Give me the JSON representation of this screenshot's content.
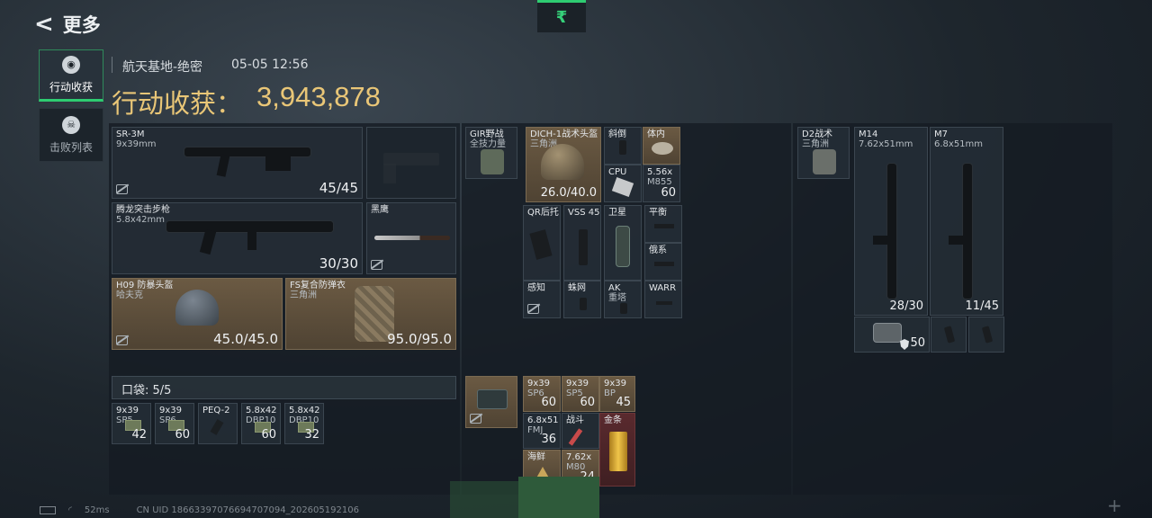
{
  "nav": {
    "back_label": "更多",
    "currency_symbol": "₹"
  },
  "tabs": [
    {
      "label": "行动收获",
      "active": true,
      "icon": "loot-icon"
    },
    {
      "label": "击败列表",
      "active": false,
      "icon": "skull-icon"
    }
  ],
  "raid": {
    "map": "航天基地-绝密",
    "datetime": "05-05 12:56"
  },
  "loot": {
    "label": "行动收获：",
    "value": "3,943,878"
  },
  "gear": {
    "primary": {
      "name": "SR-3M",
      "caliber": "9x39mm",
      "ammo": "45/45"
    },
    "secondary": {
      "name": "腾龙突击步枪",
      "caliber": "5.8x42mm",
      "ammo": "30/30"
    },
    "melee": {
      "name": "黑鹰"
    },
    "helmet": {
      "name": "H09 防暴头盔",
      "maker": "哈夫克",
      "durability": "45.0/45.0"
    },
    "armor": {
      "name": "FS复合防弹衣",
      "maker": "三角洲",
      "durability": "95.0/95.0"
    }
  },
  "pocket": {
    "label": "口袋:",
    "count": "5/5",
    "items": [
      {
        "name": "9x39",
        "sub": "SP5",
        "count": "42"
      },
      {
        "name": "9x39",
        "sub": "SP6",
        "count": "60"
      },
      {
        "name": "PEQ-2",
        "sub": "",
        "count": ""
      },
      {
        "name": "5.8x42",
        "sub": "DBP10",
        "count": "60"
      },
      {
        "name": "5.8x42",
        "sub": "DBP10",
        "count": "32"
      }
    ]
  },
  "rig": {
    "name": "GIR野战",
    "sub": "全技力量",
    "helmet_item": {
      "name": "DICH-1战术头盔",
      "sub": "三角洲",
      "durability": "26.0/40.0"
    },
    "small_items": [
      {
        "name": "斜倒",
        "count": ""
      },
      {
        "name": "体内",
        "count": ""
      },
      {
        "name": "CPU",
        "count": ""
      },
      {
        "name": "5.56x",
        "sub": "M855",
        "count": "60"
      },
      {
        "name": "QR后托",
        "count": ""
      },
      {
        "name": "VSS 45",
        "count": ""
      },
      {
        "name": "卫星",
        "count": ""
      },
      {
        "name": "平衡",
        "count": ""
      },
      {
        "name": "俄系",
        "count": ""
      },
      {
        "name": "感知",
        "count": ""
      },
      {
        "name": "蛛网",
        "count": ""
      },
      {
        "name": "AK",
        "sub": "重塔",
        "count": ""
      },
      {
        "name": "WARR",
        "count": ""
      }
    ]
  },
  "backpack": {
    "items": [
      {
        "name": "9x39",
        "sub": "SP6",
        "count": "60"
      },
      {
        "name": "9x39",
        "sub": "SP5",
        "count": "60"
      },
      {
        "name": "9x39",
        "sub": "BP",
        "count": "45"
      },
      {
        "name": "6.8x51",
        "sub": "FMJ",
        "count": "36"
      },
      {
        "name": "战斗",
        "count": ""
      },
      {
        "name": "金条",
        "count": ""
      },
      {
        "name": "海鲜",
        "count": ""
      },
      {
        "name": "7.62x",
        "sub": "M80",
        "count": "24"
      }
    ]
  },
  "safe_box": {
    "name": "D2战术",
    "sub": "三角洲",
    "weapons": [
      {
        "name": "M14",
        "caliber": "7.62x51mm",
        "ammo": "28/30"
      },
      {
        "name": "M7",
        "caliber": "6.8x51mm",
        "ammo": "11/45"
      }
    ],
    "armor_plates": "50"
  },
  "footer": {
    "ping": "52ms",
    "uid": "CN UID 186633970766947070​94_202605192106"
  }
}
